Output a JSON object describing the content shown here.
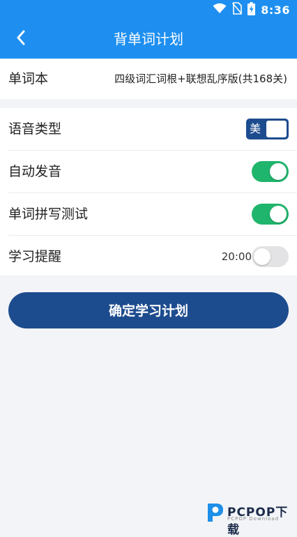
{
  "status_bar": {
    "time": "8:36"
  },
  "app_bar": {
    "title": "背单词计划"
  },
  "wordbook": {
    "label": "单词本",
    "value": "四级词汇词根+联想乱序版(共168关)"
  },
  "settings": {
    "voice_type": {
      "label": "语音类型",
      "option": "美"
    },
    "auto_pronounce": {
      "label": "自动发音",
      "on": true
    },
    "spelling_test": {
      "label": "单词拼写测试",
      "on": true
    },
    "study_reminder": {
      "label": "学习提醒",
      "time": "20:00",
      "on": false
    }
  },
  "confirm_button": {
    "label": "确定学习计划"
  },
  "watermark": {
    "brand": "PCPOP下载",
    "sub": "PCPOP Download"
  },
  "colors": {
    "primary": "#1e8ff0",
    "button": "#1d4c8e",
    "toggle_on": "#1fb56c",
    "toggle_off": "#e3e3e6"
  }
}
